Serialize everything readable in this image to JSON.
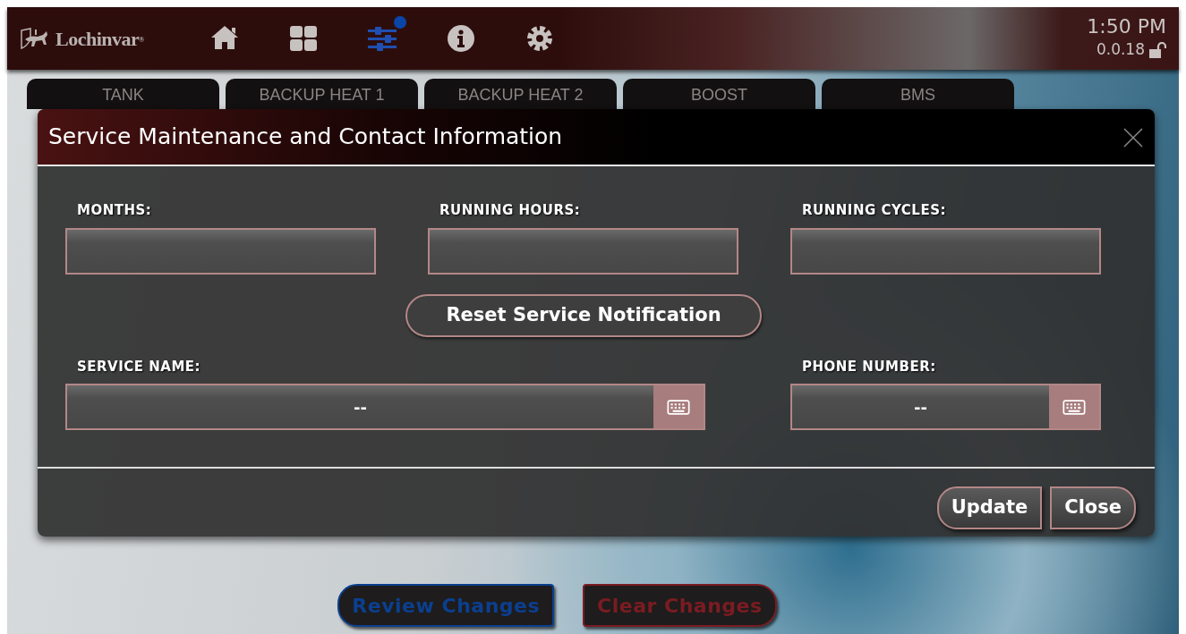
{
  "header": {
    "logo": "Lochinvar$^{®}$",
    "nav": [
      {
        "kind": "home",
        "selected": false,
        "notification": false
      },
      {
        "kind": "grid",
        "selected": false,
        "notification": false
      },
      {
        "kind": "sliders",
        "selected": true,
        "notification": true
      },
      {
        "kind": "info",
        "selected": false,
        "notification": false
      },
      {
        "kind": "gear",
        "selected": false,
        "notification": false
      }
    ],
    "time": "1:50 PM",
    "version": "0.0.18",
    "locked": false
  },
  "tabs": [
    "TANK",
    "BACKUP HEAT 1",
    "BACKUP HEAT 2",
    "BOOST",
    "BMS"
  ],
  "modal": {
    "title": "Service Maintenance and Contact Information",
    "counters": [
      {
        "label": "MONTHS:"
      },
      {
        "label": "RUNNING HOURS:"
      },
      {
        "label": "RUNNING CYCLES:"
      }
    ],
    "reset_button": "Reset Service Notification",
    "contacts": [
      {
        "label": "SERVICE NAME:",
        "value": "--",
        "wide": true
      },
      {
        "label": "PHONE NUMBER:",
        "value": "--",
        "wide": false
      }
    ],
    "buttons": [
      "Update",
      "Close"
    ]
  },
  "actions": [
    {
      "label": "Review Changes",
      "color": "#0b3f8f"
    },
    {
      "label": "Clear Changes",
      "color": "#7a1c22"
    }
  ]
}
